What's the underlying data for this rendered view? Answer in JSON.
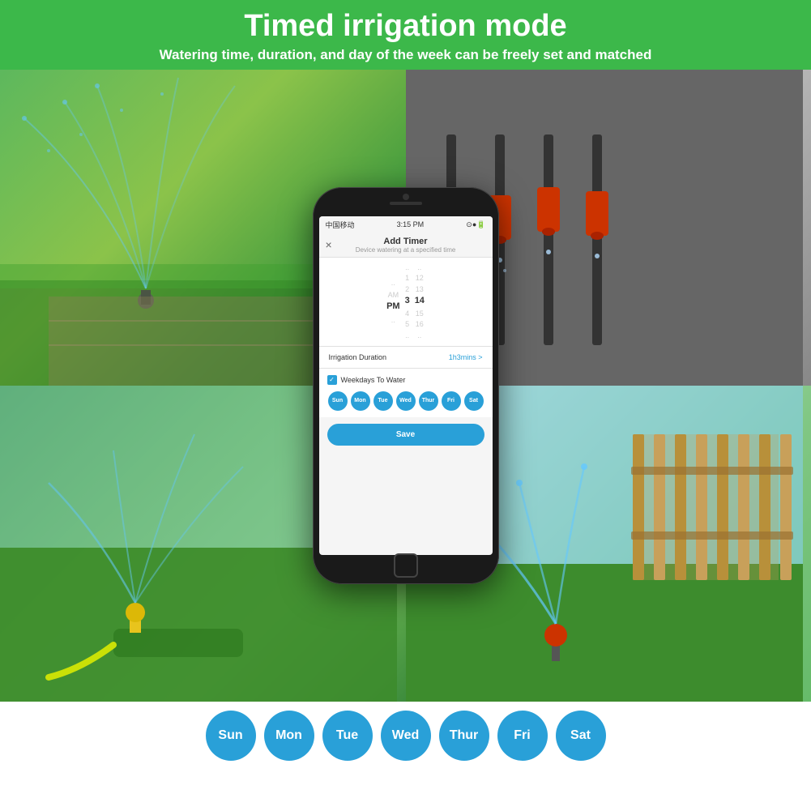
{
  "header": {
    "title": "Timed irrigation mode",
    "subtitle": "Watering time, duration, and day of the week can be freely set and matched"
  },
  "phone": {
    "status_bar": {
      "carrier": "中国移动",
      "wifi": "wifi",
      "time": "3:15 PM",
      "icons": "⊙ ●"
    },
    "screen": {
      "title": "Add Timer",
      "subtitle": "Device watering at a specified time",
      "close_btn": "×",
      "time_picker": {
        "am_pm": [
          "",
          "AM",
          "PM",
          "",
          ""
        ],
        "hours": [
          "..",
          "1",
          "2",
          "3",
          "4",
          "5",
          ".."
        ],
        "minutes": [
          "..",
          "12",
          "13",
          "14",
          "15",
          "16",
          ".."
        ]
      },
      "duration_label": "Irrigation Duration",
      "duration_value": "1h3mins >",
      "weekdays_label": "Weekdays To Water",
      "days": [
        "Sun",
        "Mon",
        "Tue",
        "Wed",
        "Thur",
        "Fri",
        "Sat"
      ],
      "save_label": "Save"
    }
  },
  "bottom_days": {
    "items": [
      "Sun",
      "Mon",
      "Tue",
      "Wed",
      "Thur",
      "Fri",
      "Sat"
    ]
  },
  "colors": {
    "green_bg": "#3cb84a",
    "blue_accent": "#29a0d8",
    "white": "#ffffff"
  }
}
